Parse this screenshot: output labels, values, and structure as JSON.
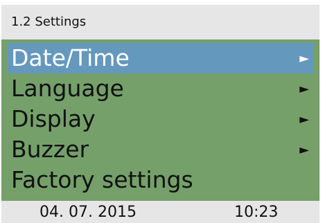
{
  "header": {
    "title": "1.2 Settings"
  },
  "menu": {
    "items": [
      {
        "label": "Date/Time",
        "arrow": "►",
        "selected": true
      },
      {
        "label": "Language",
        "arrow": "►",
        "selected": false
      },
      {
        "label": "Display",
        "arrow": "►",
        "selected": false
      },
      {
        "label": "Buzzer",
        "arrow": "►",
        "selected": false
      },
      {
        "label": "Factory settings",
        "arrow": "",
        "selected": false
      }
    ]
  },
  "footer": {
    "date": "04. 07. 2015",
    "time": "10:23"
  },
  "colors": {
    "menu_background": "#75a06a",
    "selected_background": "#6598bd",
    "bar_background": "#e6e6e6"
  }
}
